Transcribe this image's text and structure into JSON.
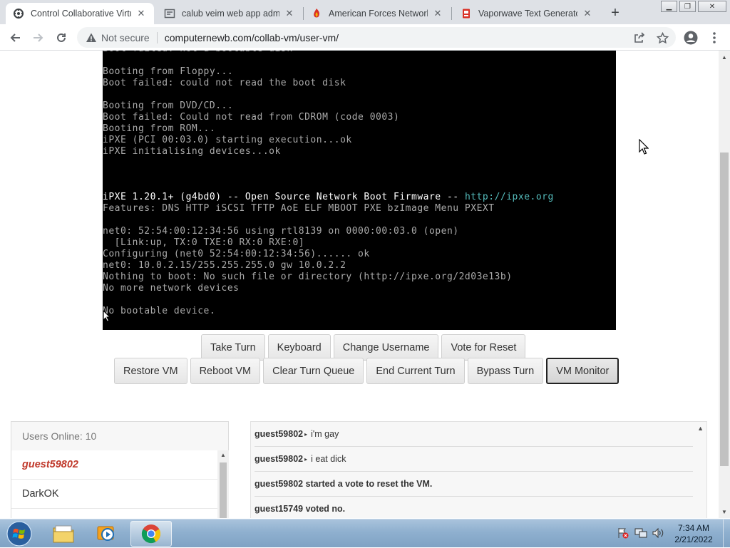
{
  "browser": {
    "tabs": [
      {
        "title": "Control Collaborative Virtu",
        "active": true
      },
      {
        "title": "calub veim web app admin",
        "active": false
      },
      {
        "title": "American Forces Network |",
        "active": false
      },
      {
        "title": "Vaporwave Text Generator",
        "active": false
      }
    ],
    "security_label": "Not secure",
    "url": "computernewb.com/collab-vm/user-vm/"
  },
  "console": {
    "lines": [
      {
        "text": "Boot failed: not a bootable disk",
        "bright": false
      },
      {
        "text": "",
        "bright": false
      },
      {
        "text": "Booting from Floppy...",
        "bright": false
      },
      {
        "text": "Boot failed: could not read the boot disk",
        "bright": false
      },
      {
        "text": "",
        "bright": false
      },
      {
        "text": "Booting from DVD/CD...",
        "bright": false
      },
      {
        "text": "Boot failed: Could not read from CDROM (code 0003)",
        "bright": false
      },
      {
        "text": "Booting from ROM...",
        "bright": false
      },
      {
        "text": "iPXE (PCI 00:03.0) starting execution...ok",
        "bright": false
      },
      {
        "text": "iPXE initialising devices...ok",
        "bright": false
      },
      {
        "text": "",
        "bright": false
      },
      {
        "text": "",
        "bright": false
      },
      {
        "text": "",
        "bright": false
      },
      {
        "text": "iPXE 1.20.1+ (g4bd0) -- Open Source Network Boot Firmware -- ",
        "bright": true,
        "link": "http://ipxe.org"
      },
      {
        "text": "Features: DNS HTTP iSCSI TFTP AoE ELF MBOOT PXE bzImage Menu PXEXT",
        "bright": false
      },
      {
        "text": "",
        "bright": false
      },
      {
        "text": "net0: 52:54:00:12:34:56 using rtl8139 on 0000:00:03.0 (open)",
        "bright": false
      },
      {
        "text": "  [Link:up, TX:0 TXE:0 RX:0 RXE:0]",
        "bright": false
      },
      {
        "text": "Configuring (net0 52:54:00:12:34:56)...... ok",
        "bright": false
      },
      {
        "text": "net0: 10.0.2.15/255.255.255.0 gw 10.0.2.2",
        "bright": false
      },
      {
        "text": "Nothing to boot: No such file or directory (http://ipxe.org/2d03e13b)",
        "bright": false
      },
      {
        "text": "No more network devices",
        "bright": false
      },
      {
        "text": "",
        "bright": false
      },
      {
        "text": "No bootable device.",
        "bright": false
      }
    ]
  },
  "controls": {
    "row1": [
      "Take Turn",
      "Keyboard",
      "Change Username",
      "Vote for Reset"
    ],
    "row2": [
      "Restore VM",
      "Reboot VM",
      "Clear Turn Queue",
      "End Current Turn",
      "Bypass Turn",
      "VM Monitor"
    ]
  },
  "users": {
    "header": "Users Online: 10",
    "list": [
      {
        "name": "guest59802",
        "self": true
      },
      {
        "name": "DarkOK",
        "self": false
      }
    ]
  },
  "chat": {
    "messages": [
      {
        "user": "guest59802",
        "text": "i'm gay",
        "system": false
      },
      {
        "user": "guest59802",
        "text": "i eat dick",
        "system": false
      },
      {
        "system": true,
        "text": "guest59802 started a vote to reset the VM."
      },
      {
        "system": true,
        "text": "guest15749 voted no."
      }
    ]
  },
  "taskbar": {
    "time": "7:34 AM",
    "date": "2/21/2022"
  }
}
